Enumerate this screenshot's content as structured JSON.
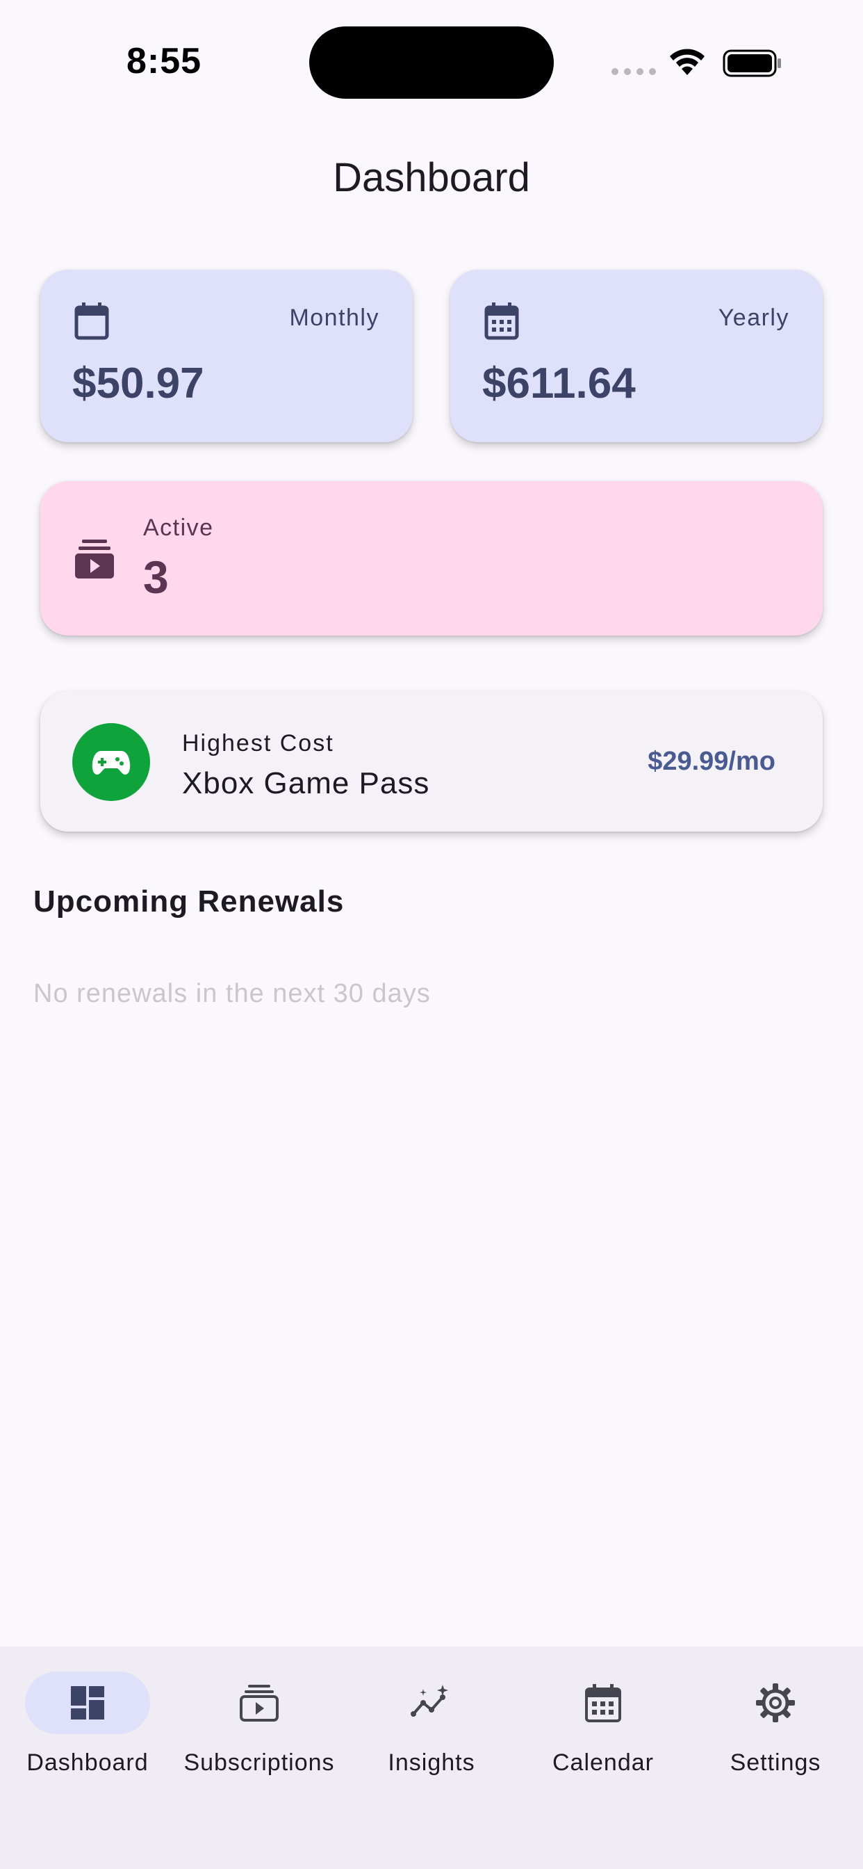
{
  "status_bar": {
    "time": "8:55"
  },
  "header": {
    "title": "Dashboard"
  },
  "stats": {
    "monthly": {
      "label": "Monthly",
      "value": "$50.97",
      "icon": "calendar-icon"
    },
    "yearly": {
      "label": "Yearly",
      "value": "$611.64",
      "icon": "calendar-month-icon"
    },
    "active": {
      "label": "Active",
      "value": "3",
      "icon": "subscriptions-icon"
    }
  },
  "highest_cost": {
    "label": "Highest Cost",
    "name": "Xbox Game Pass",
    "price": "$29.99/mo",
    "icon": "gamepad-icon",
    "icon_bg_color": "#0fa43b"
  },
  "upcoming": {
    "title": "Upcoming Renewals",
    "empty_message": "No renewals in the next 30 days"
  },
  "bottom_nav": {
    "items": [
      {
        "label": "Dashboard",
        "icon": "dashboard-icon",
        "active": true
      },
      {
        "label": "Subscriptions",
        "icon": "subscriptions-icon",
        "active": false
      },
      {
        "label": "Insights",
        "icon": "insights-icon",
        "active": false
      },
      {
        "label": "Calendar",
        "icon": "calendar-month-icon",
        "active": false
      },
      {
        "label": "Settings",
        "icon": "gear-icon",
        "active": false
      }
    ]
  },
  "colors": {
    "background": "#fbf8fd",
    "primary_container": "#dfe0f9",
    "on_primary_container": "#3c4367",
    "tertiary_container": "#ffd8ee",
    "on_tertiary_container": "#5b3551",
    "accent_price": "#4a5a92"
  }
}
